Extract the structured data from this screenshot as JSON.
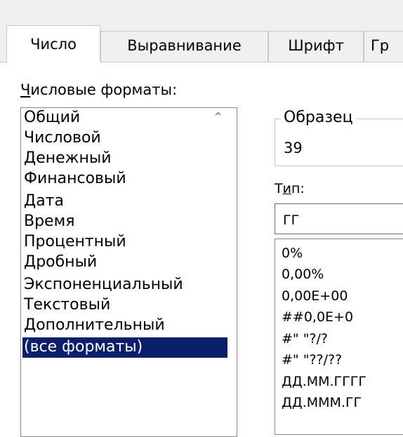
{
  "tabs": [
    "Число",
    "Выравнивание",
    "Шрифт",
    "Гр"
  ],
  "number_formats_label": "Числовые форматы:",
  "categories": [
    "Общий",
    "Числовой",
    "Денежный",
    "Финансовый",
    "Дата",
    "Время",
    "Процентный",
    "Дробный",
    "Экспоненциальный",
    "Текстовый",
    "Дополнительный",
    "(все форматы)"
  ],
  "selected_category": "(все форматы)",
  "sample": {
    "legend": "Образец",
    "value": "39"
  },
  "type": {
    "label": "Тип:",
    "value": "ГГ"
  },
  "format_codes": [
    "0%",
    "0,00%",
    "0,00E+00",
    "##0,0E+0",
    "#\" \"?/?",
    "#\" \"??/??",
    "ДД.ММ.ГГГГ",
    "ДД.МММ.ГГ"
  ],
  "icons": {
    "scroll_up": "chevron-up-icon"
  },
  "colors": {
    "selection": "#0b1f6b",
    "dialog_bg": "#f0f0f0"
  }
}
